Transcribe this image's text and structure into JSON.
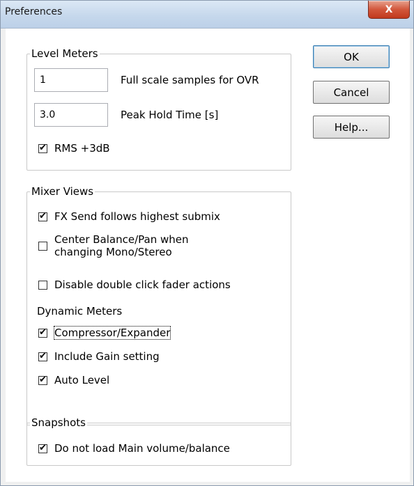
{
  "window": {
    "title": "Preferences",
    "close_label": "X"
  },
  "level_meters": {
    "legend": "Level Meters",
    "ovr_value": "1",
    "ovr_label": "Full scale samples for OVR",
    "peak_value": "3.0",
    "peak_label": "Peak Hold Time [s]",
    "rms_label": "RMS +3dB",
    "rms_checked": true
  },
  "mixer_views": {
    "legend": "Mixer Views",
    "fx_send_label": "FX Send follows highest submix",
    "center_balance_line1": "Center Balance/Pan when",
    "center_balance_line2": "changing Mono/Stereo",
    "disable_double_click_label": "Disable double click fader actions",
    "dynamic_meters_label": "Dynamic Meters",
    "compressor_label": "Compressor/Expander",
    "include_gain_label": "Include Gain setting",
    "auto_level_label": "Auto Level"
  },
  "snapshots": {
    "legend": "Snapshots",
    "do_not_load_label": "Do not load Main volume/balance"
  },
  "buttons": {
    "ok": "OK",
    "cancel": "Cancel",
    "help": "Help..."
  },
  "check_glyph": "✔"
}
